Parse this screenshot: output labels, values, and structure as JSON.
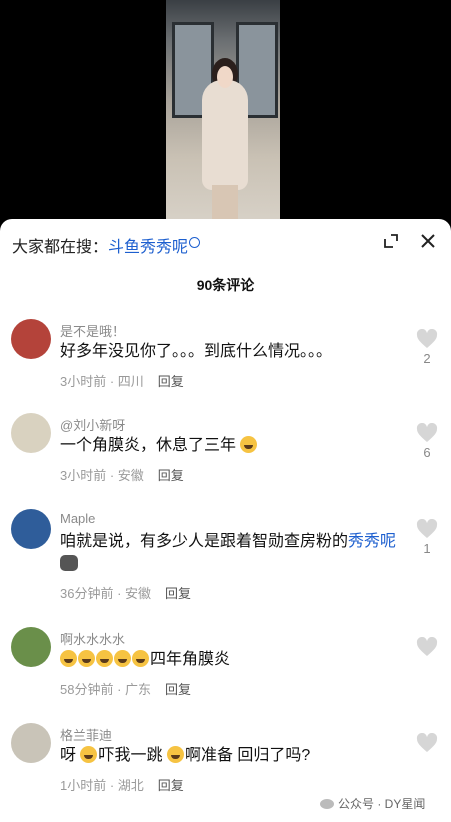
{
  "search": {
    "prefix": "大家都在搜：",
    "query": "斗鱼秀秀呢"
  },
  "header": {
    "comment_count": "90条评论"
  },
  "comments": [
    {
      "username": "是不是哦！",
      "text": "好多年没见你了。。。到底什么情况。。。",
      "time_location": "3小时前 · 四川",
      "reply": "回复",
      "likes": "2",
      "avatar_color": "#b4433a"
    },
    {
      "username": "@刘小新呀",
      "text": "一个角膜炎，休息了三年",
      "time_location": "3小时前 · 安徽",
      "reply": "回复",
      "likes": "6",
      "avatar_color": "#d9d2c0"
    },
    {
      "username": "Maple",
      "text": "咱就是说，有多少人是跟着智勋查房粉的",
      "text_link": "秀秀呢",
      "time_location": "36分钟前 · 安徽",
      "reply": "回复",
      "likes": "1",
      "avatar_color": "#2f5d9a"
    },
    {
      "username": "啊水水水水",
      "text": "四年角膜炎",
      "time_location": "58分钟前 · 广东",
      "reply": "回复",
      "likes": "",
      "avatar_color": "#6a8f4a"
    },
    {
      "username": "格兰菲迪",
      "text_parts": [
        "呀",
        "吓我一跳",
        "啊准备 回归了吗?"
      ],
      "time_location": "1小时前 · 湖北",
      "reply": "回复",
      "likes": "",
      "avatar_color": "#c9c4b8"
    }
  ],
  "watermark": "公众号 · DY星闻"
}
